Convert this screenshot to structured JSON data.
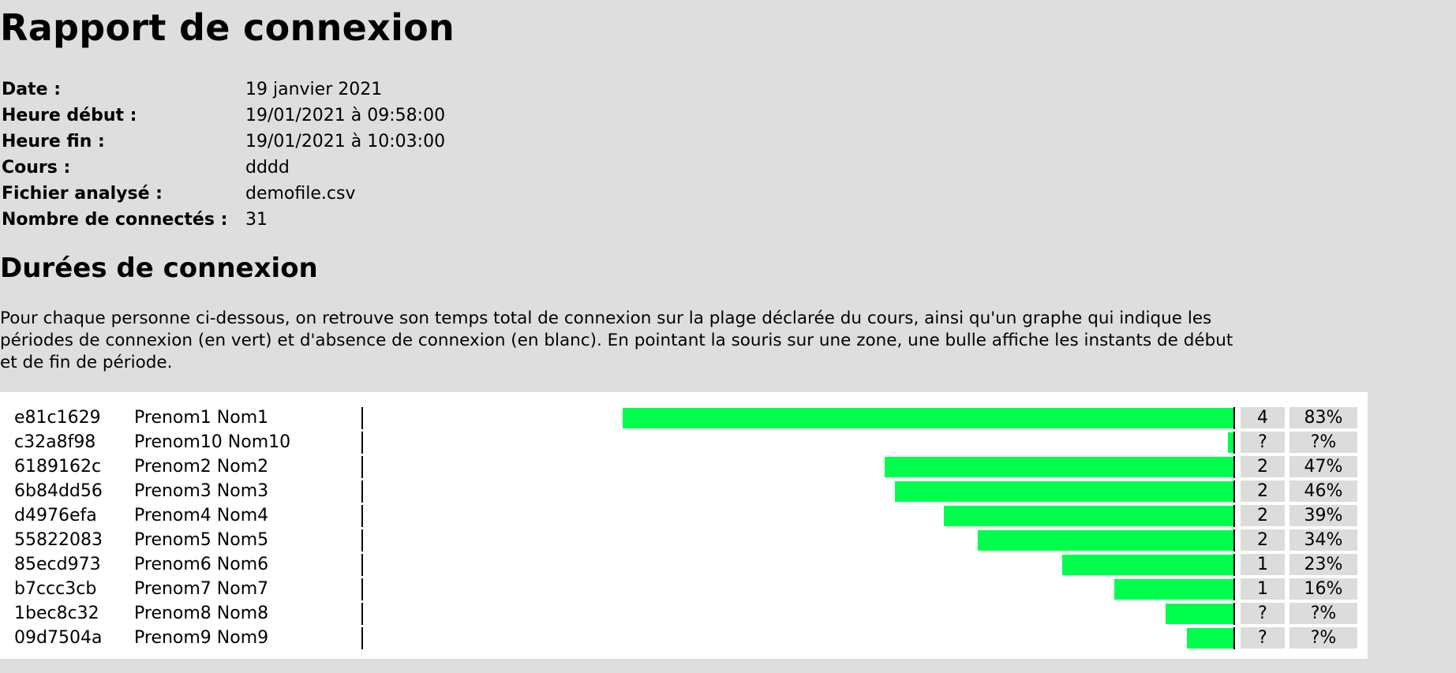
{
  "report": {
    "title": "Rapport de connexion",
    "meta": [
      {
        "label": "Date :",
        "value": "19 janvier 2021"
      },
      {
        "label": "Heure début :",
        "value": "19/01/2021 à 09:58:00"
      },
      {
        "label": "Heure fin :",
        "value": "19/01/2021 à 10:03:00"
      },
      {
        "label": "Cours :",
        "value": "dddd"
      },
      {
        "label": "Fichier analysé :",
        "value": "demofile.csv"
      },
      {
        "label": "Nombre de connectés :",
        "value": "31"
      }
    ]
  },
  "durations": {
    "heading": "Durées de connexion",
    "description": "Pour chaque personne ci-dessous, on retrouve son temps total de connexion sur la plage déclarée du cours, ainsi qu'un graphe qui indique les périodes de connexion (en vert) et d'absence de connexion (en blanc). En pointant la souris sur une zone, une bulle affiche les instants de début et de fin de période.",
    "connected_color": "#00ff4c",
    "rows": [
      {
        "id": "e81c1629",
        "name": "Prenom1 Nom1",
        "count": "4",
        "percent": "83%",
        "connected_fraction": 0.7
      },
      {
        "id": "c32a8f98",
        "name": "Prenom10 Nom10",
        "count": "?",
        "percent": "?%",
        "connected_fraction": 0.006
      },
      {
        "id": "6189162c",
        "name": "Prenom2 Nom2",
        "count": "2",
        "percent": "47%",
        "connected_fraction": 0.4
      },
      {
        "id": "6b84dd56",
        "name": "Prenom3 Nom3",
        "count": "2",
        "percent": "46%",
        "connected_fraction": 0.388
      },
      {
        "id": "d4976efa",
        "name": "Prenom4 Nom4",
        "count": "2",
        "percent": "39%",
        "connected_fraction": 0.332
      },
      {
        "id": "55822083",
        "name": "Prenom5 Nom5",
        "count": "2",
        "percent": "34%",
        "connected_fraction": 0.293
      },
      {
        "id": "85ecd973",
        "name": "Prenom6 Nom6",
        "count": "1",
        "percent": "23%",
        "connected_fraction": 0.196
      },
      {
        "id": "b7ccc3cb",
        "name": "Prenom7 Nom7",
        "count": "1",
        "percent": "16%",
        "connected_fraction": 0.137
      },
      {
        "id": "1bec8c32",
        "name": "Prenom8 Nom8",
        "count": "?",
        "percent": "?%",
        "connected_fraction": 0.078
      },
      {
        "id": "09d7504a",
        "name": "Prenom9 Nom9",
        "count": "?",
        "percent": "?%",
        "connected_fraction": 0.053
      }
    ]
  }
}
